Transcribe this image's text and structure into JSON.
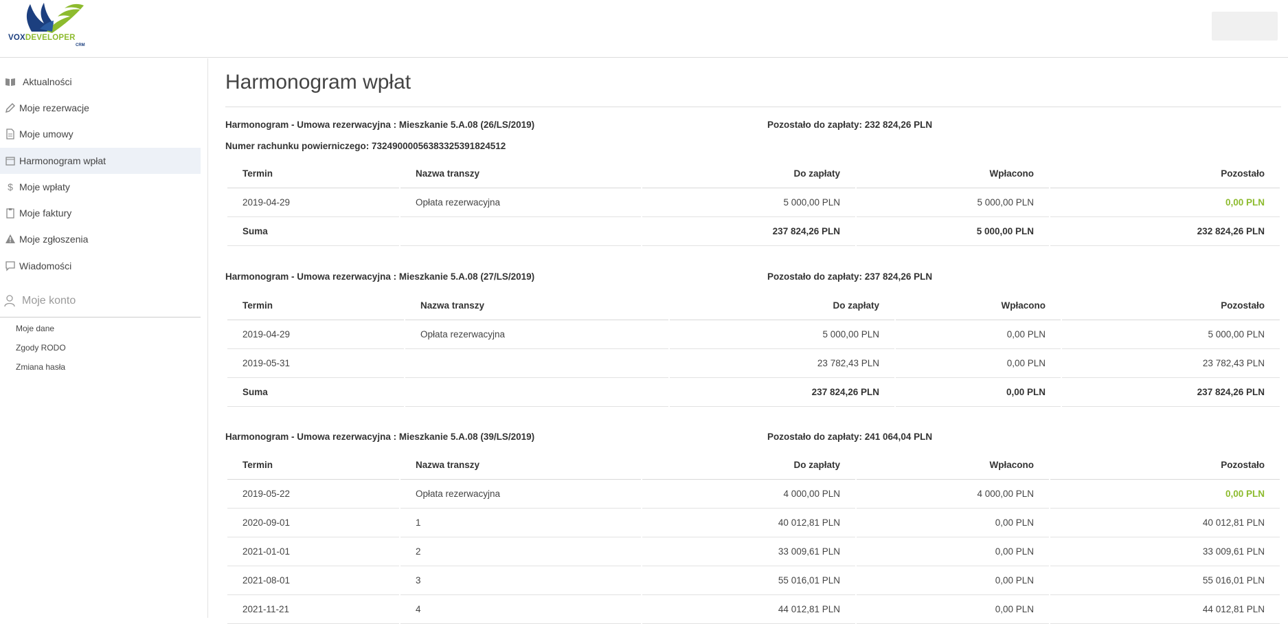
{
  "app": {
    "logo_text_a": "VOX",
    "logo_text_b": "DEVELOPER",
    "logo_sub": "CRM"
  },
  "colors": {
    "accent_green": "#8dbb2e",
    "brand_blue": "#1c3f7f",
    "active_nav_bg": "#edf1f7"
  },
  "sidebar": {
    "items": [
      {
        "label": "Aktualności",
        "icon": "book-icon"
      },
      {
        "label": "Moje rezerwacje",
        "icon": "pencil-icon"
      },
      {
        "label": "Moje umowy",
        "icon": "document-icon"
      },
      {
        "label": "Harmonogram wpłat",
        "icon": "calendar-icon",
        "active": true
      },
      {
        "label": "Moje wpłaty",
        "icon": "dollar-icon"
      },
      {
        "label": "Moje faktury",
        "icon": "clipboard-icon"
      },
      {
        "label": "Moje zgłoszenia",
        "icon": "warning-icon"
      },
      {
        "label": "Wiadomości",
        "icon": "chat-icon"
      }
    ],
    "account": {
      "label": "Moje konto",
      "icon": "user-icon",
      "items": [
        "Moje dane",
        "Zgody RODO",
        "Zmiana hasła"
      ]
    }
  },
  "main": {
    "title": "Harmonogram wpłat",
    "blocks": [
      {
        "title": "Harmonogram - Umowa rezerwacyjna : Mieszkanie 5.A.08 (26/LS/2019)",
        "remaining": "Pozostało do zapłaty: 232 824,26 PLN",
        "account": "Numer rachunku powierniczego: 73249000056383325391824512",
        "headers": [
          "Termin",
          "Nazwa transzy",
          "Do zapłaty",
          "Wpłacono",
          "Pozostało"
        ],
        "rows": [
          [
            "2019-04-29",
            "Opłata rezerwacyjna",
            "5 000,00 PLN",
            "5 000,00 PLN",
            "0,00 PLN"
          ]
        ],
        "sum": [
          "Suma",
          "",
          "237 824,26 PLN",
          "5 000,00 PLN",
          "232 824,26 PLN"
        ]
      },
      {
        "title": "Harmonogram - Umowa rezerwacyjna : Mieszkanie 5.A.08 (27/LS/2019)",
        "remaining": "Pozostało do zapłaty: 237 824,26 PLN",
        "headers": [
          "Termin",
          "Nazwa transzy",
          "Do zapłaty",
          "Wpłacono",
          "Pozostało"
        ],
        "rows": [
          [
            "2019-04-29",
            "Opłata rezerwacyjna",
            "5 000,00 PLN",
            "0,00 PLN",
            "5 000,00 PLN"
          ],
          [
            "2019-05-31",
            "",
            "23 782,43 PLN",
            "0,00 PLN",
            "23 782,43 PLN"
          ]
        ],
        "sum": [
          "Suma",
          "",
          "237 824,26 PLN",
          "0,00 PLN",
          "237 824,26 PLN"
        ]
      },
      {
        "title": "Harmonogram - Umowa rezerwacyjna : Mieszkanie 5.A.08 (39/LS/2019)",
        "remaining": "Pozostało do zapłaty: 241 064,04 PLN",
        "headers": [
          "Termin",
          "Nazwa transzy",
          "Do zapłaty",
          "Wpłacono",
          "Pozostało"
        ],
        "rows": [
          [
            "2019-05-22",
            "Opłata rezerwacyjna",
            "4 000,00 PLN",
            "4 000,00 PLN",
            "0,00 PLN"
          ],
          [
            "2020-09-01",
            "1",
            "40 012,81 PLN",
            "0,00 PLN",
            "40 012,81 PLN"
          ],
          [
            "2021-01-01",
            "2",
            "33 009,61 PLN",
            "0,00 PLN",
            "33 009,61 PLN"
          ],
          [
            "2021-08-01",
            "3",
            "55 016,01 PLN",
            "0,00 PLN",
            "55 016,01 PLN"
          ],
          [
            "2021-11-21",
            "4",
            "44 012,81 PLN",
            "0,00 PLN",
            "44 012,81 PLN"
          ]
        ]
      }
    ]
  }
}
